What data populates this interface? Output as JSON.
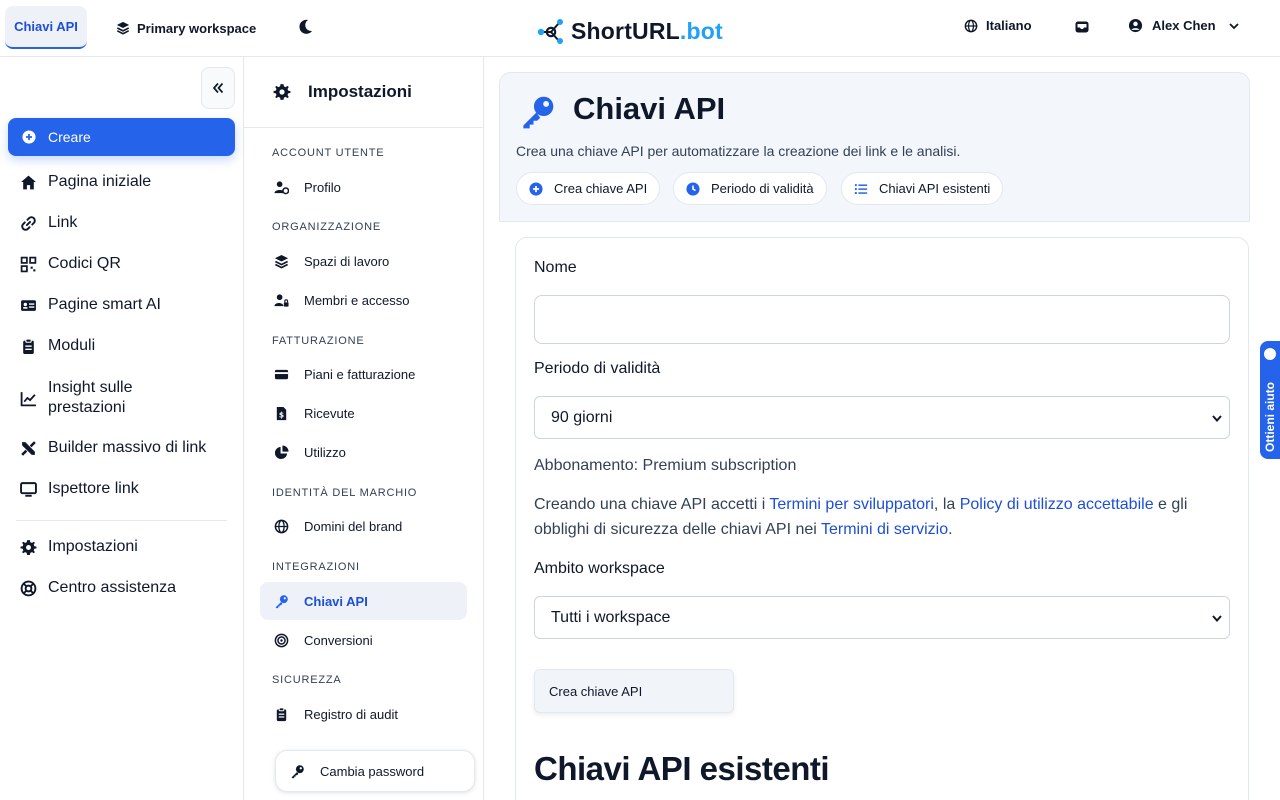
{
  "topbar": {
    "active_tab": "Chiavi API",
    "workspace": "Primary workspace",
    "logo_main": "ShortURL",
    "logo_suffix": ".bot",
    "language": "Italiano",
    "user_name": "Alex Chen"
  },
  "leftnav": {
    "create_label": "Creare",
    "items": [
      {
        "label": "Pagina iniziale",
        "icon": "home-icon"
      },
      {
        "label": "Link",
        "icon": "link-icon"
      },
      {
        "label": "Codici QR",
        "icon": "qr-code-icon"
      },
      {
        "label": "Pagine smart AI",
        "icon": "id-card-icon"
      },
      {
        "label": "Moduli",
        "icon": "clipboard-icon"
      },
      {
        "label": "Insight sulle prestazioni",
        "icon": "chart-line-icon"
      },
      {
        "label": "Builder massivo di link",
        "icon": "tools-icon"
      },
      {
        "label": "Ispettore link",
        "icon": "monitor-icon"
      },
      {
        "label": "Impostazioni",
        "icon": "gear-icon"
      },
      {
        "label": "Centro assistenza",
        "icon": "lifebuoy-icon"
      }
    ]
  },
  "settings": {
    "title": "Impostazioni",
    "sections": [
      {
        "label": "ACCOUNT UTENTE"
      },
      {
        "label": "ORGANIZZAZIONE"
      },
      {
        "label": "FATTURAZIONE"
      },
      {
        "label": "IDENTITÀ DEL MARCHIO"
      },
      {
        "label": "INTEGRAZIONI"
      },
      {
        "label": "SICUREZZA"
      }
    ],
    "items": [
      {
        "label": "Profilo",
        "icon": "user-gear-icon"
      },
      {
        "label": "Spazi di lavoro",
        "icon": "layers-icon"
      },
      {
        "label": "Membri e accesso",
        "icon": "user-lock-icon"
      },
      {
        "label": "Piani e fatturazione",
        "icon": "credit-card-icon"
      },
      {
        "label": "Ricevute",
        "icon": "receipt-icon"
      },
      {
        "label": "Utilizzo",
        "icon": "pie-chart-icon"
      },
      {
        "label": "Domini del brand",
        "icon": "globe-icon"
      },
      {
        "label": "Chiavi API",
        "icon": "key-icon"
      },
      {
        "label": "Conversioni",
        "icon": "target-icon"
      },
      {
        "label": "Registro di audit",
        "icon": "clipboard-list-icon"
      },
      {
        "label": "Cambia password",
        "icon": "key-icon"
      }
    ]
  },
  "main": {
    "title": "Chiavi API",
    "subtitle": "Crea una chiave API per automatizzare la creazione dei link e le analisi.",
    "pills": [
      {
        "label": "Crea chiave API",
        "icon": "plus-circle-icon"
      },
      {
        "label": "Periodo di validità",
        "icon": "clock-icon"
      },
      {
        "label": "Chiavi API esistenti",
        "icon": "list-icon"
      }
    ],
    "form": {
      "name_label": "Nome",
      "name_value": "",
      "validity_label": "Periodo di validità",
      "validity_value": "90 giorni",
      "plan_text": "Abbonamento: Premium subscription",
      "terms_1": "Creando una chiave API accetti i ",
      "terms_link_1": "Termini per sviluppatori",
      "terms_2": ", la ",
      "terms_link_2": "Policy di utilizzo accettabile",
      "terms_3": " e gli obblighi di sicurezza delle chiavi API nei ",
      "terms_link_3": "Termini di servizio",
      "terms_4": ".",
      "scope_label": "Ambito workspace",
      "scope_value": "Tutti i workspace",
      "submit_label": "Crea chiave API"
    },
    "existing_title": "Chiavi API esistenti"
  },
  "help": {
    "label": "Ottieni aiuto"
  },
  "colors": {
    "accent": "#2563eb",
    "accent_text": "#1d4ed8",
    "logo_suffix": "#22a0f5"
  }
}
